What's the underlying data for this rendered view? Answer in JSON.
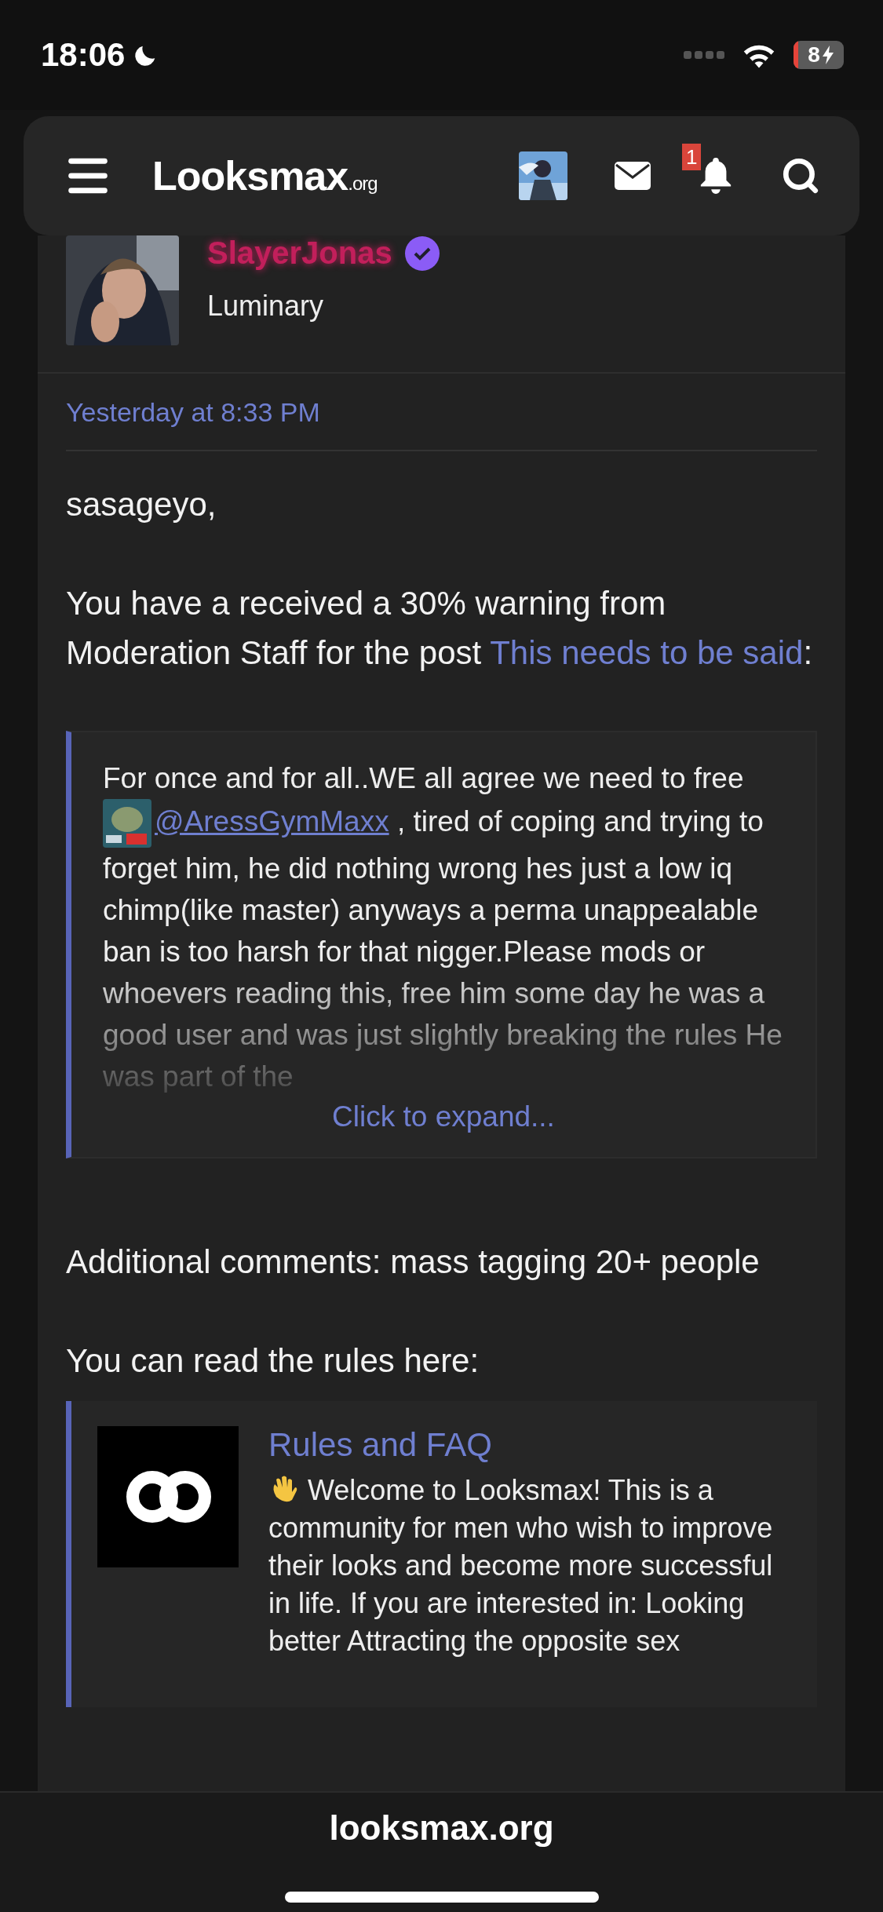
{
  "status_bar": {
    "time": "18:06",
    "battery": "8"
  },
  "header": {
    "logo": "Looksmax",
    "logo_suffix": ".org",
    "notification_count": "1"
  },
  "post": {
    "author": "SlayerJonas",
    "verified": true,
    "user_title": "Luminary",
    "date": "Yesterday at 8:33 PM",
    "greeting": "sasageyo,",
    "warning": {
      "before": "You have a received a 30% warning from Moderation Staff for the post ",
      "link": "This needs to be said",
      "after": ":"
    },
    "quote": {
      "before": "For once and for all..WE all agree we need to free ",
      "mention": "@AressGymMaxx",
      "after": " , tired of coping and trying to forget him, he did nothing wrong hes just a low iq chimp(like master) anyways a perma unappealable ban is too harsh for that nigger.Please mods or whoevers reading this, free him some day he was a good user and was just slightly breaking the rules He was part of the",
      "expand": "Click to expand..."
    },
    "comments": "Additional comments: mass tagging 20+ people",
    "rules_intro": "You can read the rules here:",
    "rules_card": {
      "title": "Rules and FAQ",
      "text": "Welcome to Looksmax! This is a community for men who wish to improve their looks and become more successful in life. If you are interested in: Looking better Attracting the opposite sex"
    }
  },
  "browser": {
    "url": "looksmax.org"
  }
}
